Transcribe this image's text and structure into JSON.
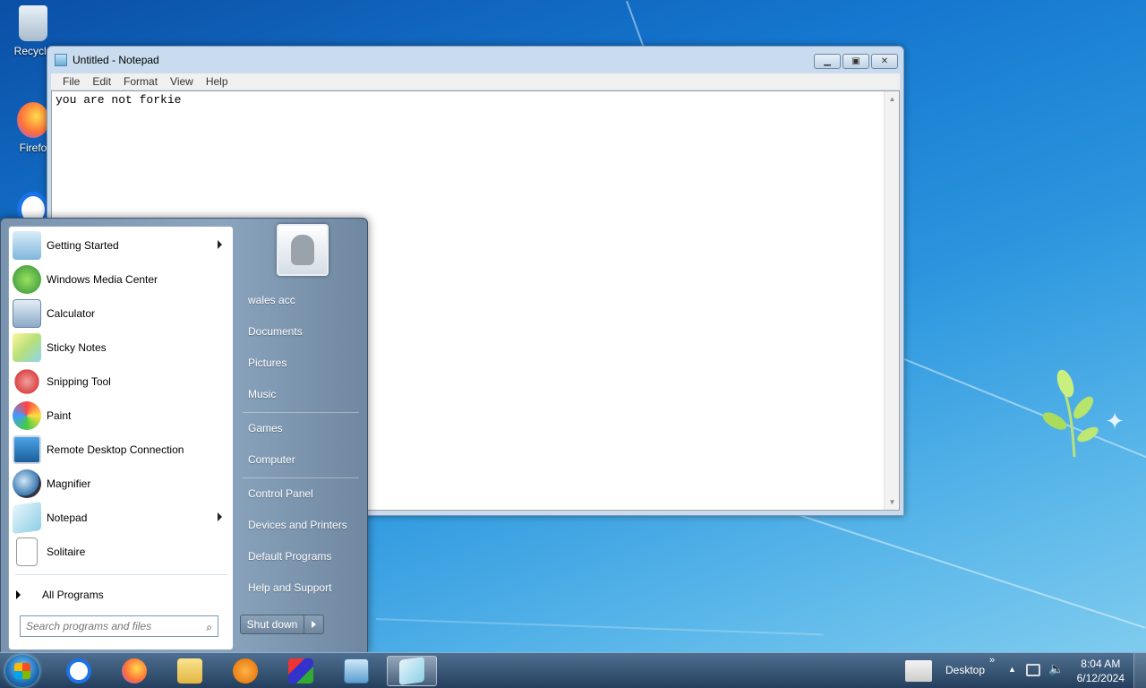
{
  "desktop": {
    "icons": [
      {
        "label": "Recycle"
      },
      {
        "label": "Firefo"
      }
    ]
  },
  "notepad": {
    "title": "Untitled - Notepad",
    "menu": [
      "File",
      "Edit",
      "Format",
      "View",
      "Help"
    ],
    "content": "you are not forkie"
  },
  "start_menu": {
    "programs": [
      {
        "label": "Getting Started",
        "has_submenu": true
      },
      {
        "label": "Windows Media Center",
        "has_submenu": false
      },
      {
        "label": "Calculator",
        "has_submenu": false
      },
      {
        "label": "Sticky Notes",
        "has_submenu": false
      },
      {
        "label": "Snipping Tool",
        "has_submenu": false
      },
      {
        "label": "Paint",
        "has_submenu": false
      },
      {
        "label": "Remote Desktop Connection",
        "has_submenu": false
      },
      {
        "label": "Magnifier",
        "has_submenu": false
      },
      {
        "label": "Notepad",
        "has_submenu": true
      },
      {
        "label": "Solitaire",
        "has_submenu": false
      }
    ],
    "all_programs": "All Programs",
    "search_placeholder": "Search programs and files",
    "right_items": [
      "wales acc",
      "Documents",
      "Pictures",
      "Music",
      "Games",
      "Computer",
      "Control Panel",
      "Devices and Printers",
      "Default Programs",
      "Help and Support"
    ],
    "shutdown_label": "Shut down"
  },
  "taskbar": {
    "toolbar_label": "Desktop",
    "time": "8:04 AM",
    "date": "6/12/2024"
  }
}
